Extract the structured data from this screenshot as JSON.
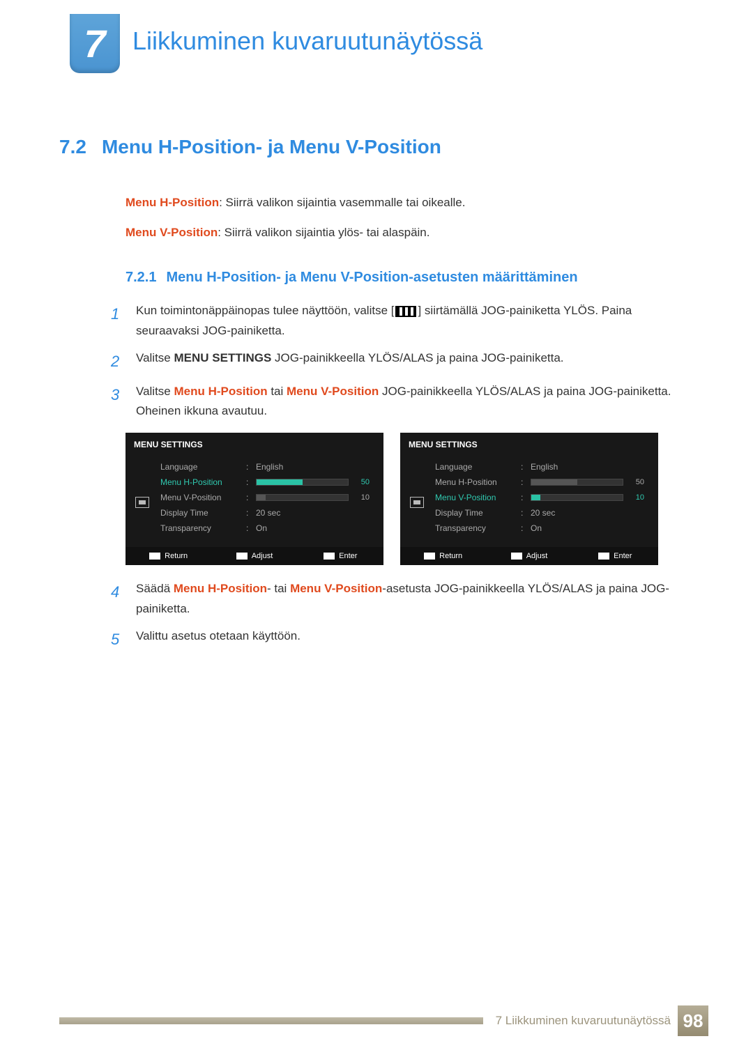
{
  "chapter": {
    "number": "7",
    "title": "Liikkuminen kuvaruutunäytössä"
  },
  "section": {
    "number": "7.2",
    "title": "Menu H-Position- ja Menu V-Position"
  },
  "desc_h_label": "Menu H-Position",
  "desc_h_text": ": Siirrä valikon sijaintia vasemmalle tai oikealle.",
  "desc_v_label": "Menu V-Position",
  "desc_v_text": ": Siirrä valikon sijaintia ylös- tai alaspäin.",
  "subsection": {
    "number": "7.2.1",
    "title": "Menu H-Position- ja Menu V-Position-asetusten määrittäminen"
  },
  "steps": {
    "s1a": "Kun toimintonäppäinopas tulee näyttöön, valitse [",
    "s1b": "] siirtämällä JOG-painiketta YLÖS. Paina seuraavaksi JOG-painiketta.",
    "s2a": "Valitse ",
    "s2b": "MENU SETTINGS",
    "s2c": " JOG-painikkeella YLÖS/ALAS ja paina JOG-painiketta.",
    "s3a": "Valitse ",
    "s3b": "Menu H-Position",
    "s3c": " tai ",
    "s3d": "Menu V-Position",
    "s3e": " JOG-painikkeella YLÖS/ALAS ja paina JOG-painiketta. Oheinen ikkuna avautuu.",
    "s4a": "Säädä ",
    "s4b": "Menu H-Position",
    "s4c": "- tai ",
    "s4d": "Menu V-Position",
    "s4e": "-asetusta JOG-painikkeella YLÖS/ALAS ja paina JOG-painiketta.",
    "s5": "Valittu asetus otetaan käyttöön."
  },
  "step_nums": {
    "n1": "1",
    "n2": "2",
    "n3": "3",
    "n4": "4",
    "n5": "5"
  },
  "osd": {
    "title": "MENU SETTINGS",
    "rows": {
      "lang_label": "Language",
      "lang_val": "English",
      "hpos_label": "Menu H-Position",
      "hpos_val": "50",
      "vpos_label": "Menu V-Position",
      "vpos_val": "10",
      "time_label": "Display Time",
      "time_val": "20 sec",
      "tran_label": "Transparency",
      "tran_val": "On"
    },
    "footer": {
      "return": "Return",
      "adjust": "Adjust",
      "enter": "Enter"
    }
  },
  "footer": {
    "text": "7 Liikkuminen kuvaruutunäytössä",
    "page": "98"
  }
}
